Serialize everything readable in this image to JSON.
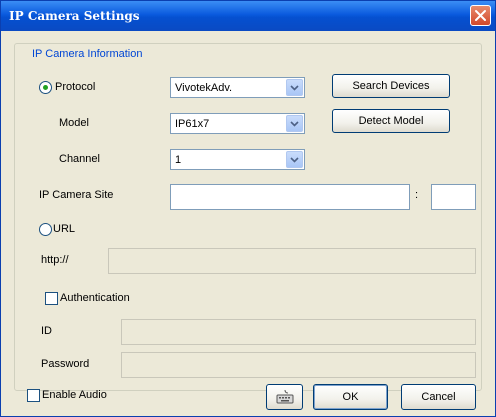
{
  "window": {
    "title": "IP Camera Settings"
  },
  "group": {
    "legend": "IP Camera Information"
  },
  "protocol": {
    "label": "Protocol",
    "selected": true,
    "value": "VivotekAdv."
  },
  "model": {
    "label": "Model",
    "value": "IP61x7"
  },
  "channel": {
    "label": "Channel",
    "value": "1"
  },
  "site": {
    "label": "IP Camera Site",
    "host_value": "",
    "colon": ":",
    "port_value": ""
  },
  "url": {
    "label": "URL",
    "selected": false,
    "prefix": "http://",
    "value": ""
  },
  "auth": {
    "label": "Authentication",
    "checked": false,
    "id_label": "ID",
    "id_value": "",
    "password_label": "Password",
    "password_value": ""
  },
  "buttons": {
    "search_devices": "Search Devices",
    "detect_model": "Detect Model",
    "ok": "OK",
    "cancel": "Cancel",
    "keyboard_icon": "keyboard-icon"
  },
  "audio": {
    "label": "Enable Audio",
    "checked": false
  },
  "colors": {
    "titlebar": "#0a5ade",
    "dialog_bg": "#ece9d8",
    "legend_text": "#0046d5",
    "close_button": "#d2482a"
  }
}
